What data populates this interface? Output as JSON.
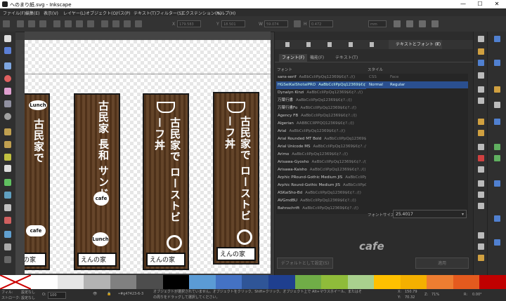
{
  "window": {
    "title": "へのまり紙.svg - Inkscape",
    "controls": [
      "—",
      "☐",
      "✕"
    ]
  },
  "menu": [
    "ファイル(F)",
    "編集(E)",
    "表示(V)",
    "レイヤー(L)",
    "オブジェクト(O)",
    "パス(P)",
    "テキスト(T)",
    "フィルター(S)",
    "エクステンション(N)",
    "ヘルプ(H)"
  ],
  "toolbar": {
    "x_label": "X",
    "x_value": "179.583",
    "y_label": "Y",
    "y_value": "18.501",
    "w_label": "W",
    "w_value": "59.074",
    "h_label": "H",
    "h_value": "0.472",
    "unit": "mm"
  },
  "canvas": {
    "signs": [
      {
        "text": "古民家で",
        "badge": "cafe",
        "badge2": "Lunch",
        "foot": "えんの家"
      },
      {
        "text": "古民家 長和 サンド",
        "badge": "cafe",
        "badge2": "Lunch",
        "foot": "えんの家"
      },
      {
        "text": "古民家で ローストビーフ丼",
        "foot": "えんの家"
      },
      {
        "text": "古民家で ローストビーフ丼",
        "foot": "えんの家"
      }
    ]
  },
  "dialog": {
    "active_tab": "テキストとフォント (T)",
    "active_tab_close": "✕",
    "subtabs": [
      "フォント(F)",
      "機能(F)",
      "テキスト(T)"
    ],
    "font_family_label": "フォント",
    "style_label": "スタイル",
    "style_header": {
      "css": "CSS",
      "face": "Face"
    },
    "style_rows": [
      {
        "css": "Normal",
        "face": "Regular",
        "selected": true
      }
    ],
    "fonts": [
      {
        "name": "sans-serif",
        "sample": "AaBbCcIiPpQq12369$€¢?.:/()",
        "selected": false
      },
      {
        "name": "HGSeiKaiShotaiPRO",
        "sample": "AaBbCcIiPpQq12369$€¢?.:/()",
        "selected": true
      },
      {
        "name": "Dynalyn Kinzi",
        "sample": "AaBbCcIiPpQq12369$€¢?.:/()",
        "selected": false
      },
      {
        "name": "万葉行書",
        "sample": "AaBbCcIiPpQq12369$€¢?.:/()",
        "selected": false
      },
      {
        "name": "万葉行書Fo",
        "sample": "AaBbCcIiPpQq12369$€¢?.:/()",
        "selected": false
      },
      {
        "name": "Agency FB",
        "sample": "AaBbCcIiPpQq12369$€¢?.:/()",
        "selected": false
      },
      {
        "name": "Algerian",
        "sample": "AABBCCIIPPQQ12369$€¢?.:/()",
        "selected": false
      },
      {
        "name": "Arial",
        "sample": "AaBbCcIiPpQq12369$€¢?.:/()",
        "selected": false
      },
      {
        "name": "Arial Rounded MT Bold",
        "sample": "AaBbCcIiPpQq12369$€¢?.:/()",
        "selected": false
      },
      {
        "name": "Arial Unicode MS",
        "sample": "AaBbCcIiPpQq12369$€¢?.:/()",
        "selected": false
      },
      {
        "name": "Arimo",
        "sample": "AaBbCcIiPpQq12369$€¢?.:/()",
        "selected": false
      },
      {
        "name": "Arisawa-Gyosho",
        "sample": "AaBbCcIiPpQq12369$€¢?.:/()",
        "selected": false
      },
      {
        "name": "Arisawa-Kaisho",
        "sample": "AaBbCcIiPpQq12369$€¢?.:/()",
        "selected": false
      },
      {
        "name": "Arphic PRound-Gothic Medium JIS",
        "sample": "AaBbCcIiPpQq12369$€¢?.:/()",
        "selected": false
      },
      {
        "name": "Arphic Round-Gothic Medium JIS",
        "sample": "AaBbCcIiPpQq12369$€¢?.:/()",
        "selected": false
      },
      {
        "name": "ASKaiSho-Bd",
        "sample": "AaBbCcIiPpQq12369$€¢?.:/()",
        "selected": false
      },
      {
        "name": "AVGmdBU",
        "sample": "AaBbCcIiPpQq12369$€¢?.:/()",
        "selected": false
      },
      {
        "name": "Bahnschrift",
        "sample": "AaBbCcIiPpQq12369$€¢?.:/()",
        "selected": false
      }
    ],
    "size_label": "フォントサイズ",
    "size_value": "25.4017",
    "preview_text": "cafe",
    "btn_default": "デフォルトとして設定(S)",
    "btn_apply": "適用"
  },
  "palette": [
    "#ffffff",
    "#e6e6e6",
    "#b3b3b3",
    "#808080",
    "#4d4d4d",
    "#000000",
    "#5b9bd5",
    "#4472c4",
    "#2f5597",
    "#1f3f8f",
    "#70ad47",
    "#8fbc3a",
    "#a9d18e",
    "#ffc000",
    "#f4b000",
    "#ed7d31",
    "#e45a1e",
    "#c00000"
  ],
  "status": {
    "fill_label": "フィル:",
    "fill_value": "設定なし",
    "stroke_label": "ストローク:",
    "stroke_value": "設定なし",
    "opacity": "100",
    "layer": "•#g47423-6-3",
    "message": "オブジェクトが選択されていません。オブジェクトをクリック、Shift+クリック、オブジェクト上で Alt+マウスホイール、またはその周りをドラッグして選択してください。",
    "x_label": "X:",
    "x_value": "150.79",
    "y_label": "Y:",
    "y_value": "70.32",
    "z_label": "Z:",
    "zoom": "71%",
    "r_label": "R:",
    "rotation": "0.00°"
  }
}
